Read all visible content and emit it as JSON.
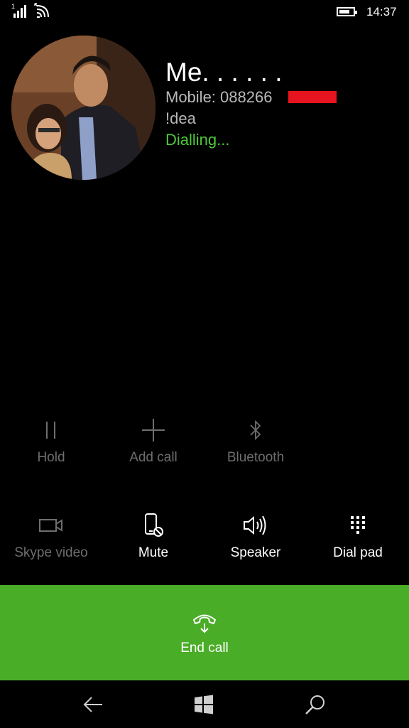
{
  "status_bar": {
    "sim_label": "1",
    "time": "14:37",
    "signal_bars": 4,
    "battery_level": 0.8,
    "icons": [
      "signal-icon",
      "wifi-calling-icon",
      "battery-icon"
    ]
  },
  "contact": {
    "name": "Me. . . . . .",
    "number": "Mobile: 088266",
    "carrier": "!dea",
    "status": "Dialling..."
  },
  "secondary_controls": [
    {
      "label": "Hold",
      "icon": "pause-icon",
      "enabled": false
    },
    {
      "label": "Add call",
      "icon": "plus-icon",
      "enabled": false
    },
    {
      "label": "Bluetooth",
      "icon": "bluetooth-icon",
      "enabled": false
    }
  ],
  "primary_controls": [
    {
      "label": "Skype video",
      "icon": "video-camera-icon",
      "enabled": false
    },
    {
      "label": "Mute",
      "icon": "mute-phone-icon",
      "enabled": true
    },
    {
      "label": "Speaker",
      "icon": "speaker-icon",
      "enabled": true
    },
    {
      "label": "Dial pad",
      "icon": "dialpad-icon",
      "enabled": true
    }
  ],
  "end_call": {
    "label": "End call",
    "icon": "end-call-icon"
  },
  "nav": {
    "icons": [
      "back-arrow-icon",
      "windows-start-icon",
      "search-icon"
    ]
  },
  "colors": {
    "background": "#000000",
    "accent_green": "#4aad28",
    "status_green": "#4ec93a",
    "disabled_text": "#6e6e6e",
    "secondary_text": "#b9b9b9",
    "redaction_red": "#e5141e"
  }
}
